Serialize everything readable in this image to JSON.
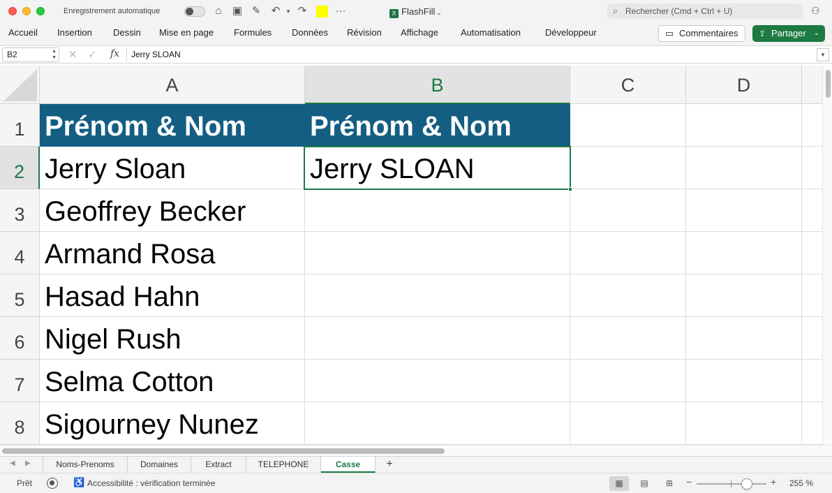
{
  "titlebar": {
    "autosave_label": "Enregistrement automatique",
    "doc_title": "FlashFill",
    "search_placeholder": "Rechercher (Cmd + Ctrl + U)"
  },
  "ribbon": {
    "tabs": [
      "Accueil",
      "Insertion",
      "Dessin",
      "Mise en page",
      "Formules",
      "Données",
      "Révision",
      "Affichage",
      "Automatisation",
      "Développeur"
    ],
    "comments_label": "Commentaires",
    "share_label": "Partager"
  },
  "formula_bar": {
    "name_box": "B2",
    "fx": "fx",
    "value": "Jerry SLOAN"
  },
  "grid": {
    "columns": [
      "A",
      "B",
      "C",
      "D"
    ],
    "selected_column": "B",
    "rows": [
      "1",
      "2",
      "3",
      "4",
      "5",
      "6",
      "7",
      "8"
    ],
    "selected_row": "2",
    "col_a": [
      "Prénom & Nom",
      "Jerry Sloan",
      "Geoffrey Becker",
      "Armand Rosa",
      "Hasad Hahn",
      "Nigel Rush",
      "Selma Cotton",
      "Sigourney Nunez"
    ],
    "col_b": [
      "Prénom & Nom",
      "Jerry SLOAN",
      "",
      "",
      "",
      "",
      "",
      ""
    ],
    "header_fill": "#135e82",
    "selection_color": "#1d7a43"
  },
  "sheets": {
    "tabs": [
      "Noms-Prenoms",
      "Domaines",
      "Extract",
      "TELEPHONE",
      "Casse"
    ],
    "active": "Casse"
  },
  "status": {
    "ready": "Prêt",
    "accessibility": "Accessibilité : vérification terminée",
    "zoom": "255 %"
  }
}
